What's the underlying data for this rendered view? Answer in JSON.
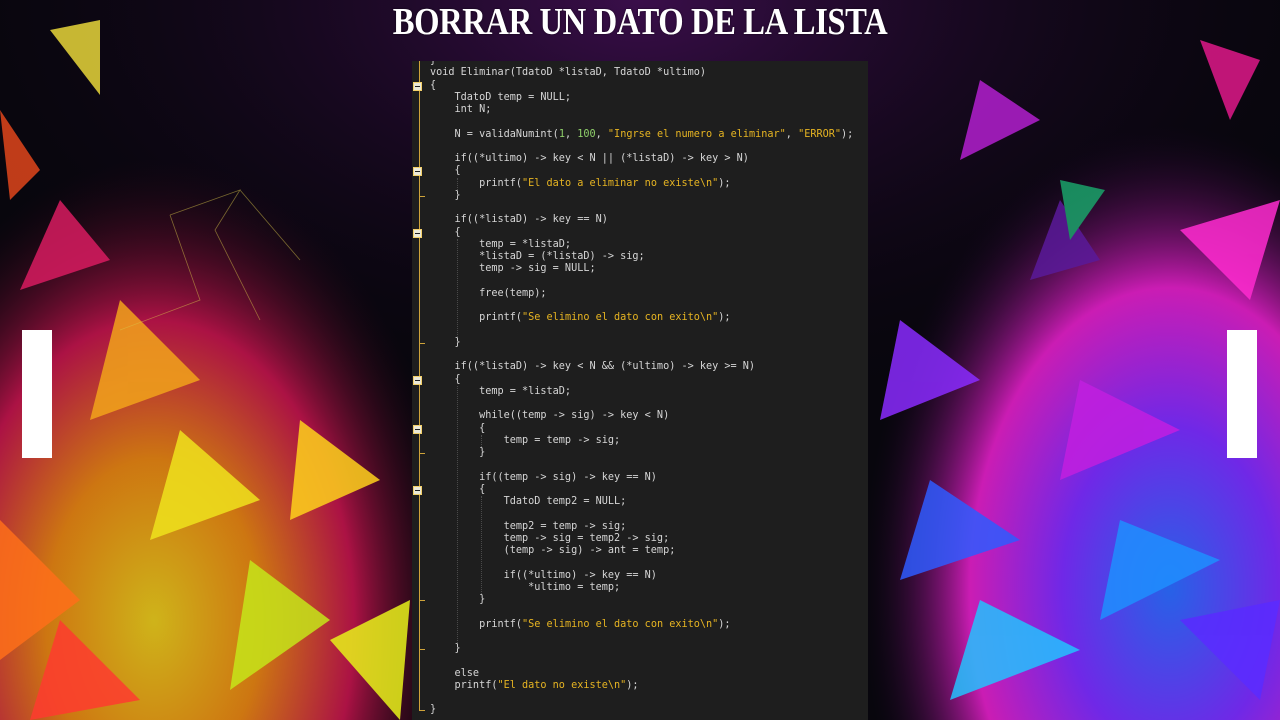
{
  "slide": {
    "title": "BORRAR UN DATO DE LA LISTA",
    "nav": {
      "prev_label": "",
      "next_label": ""
    }
  },
  "colors": {
    "editor_bg": "#1e1e1e",
    "code_text": "#d6d6d6",
    "string": "#e6b422",
    "number": "#8fcf6a",
    "fold_marker": "#cfa33a"
  },
  "editor": {
    "lines": [
      "}",
      "void Eliminar(TdatoD *listaD, TdatoD *ultimo)",
      "{",
      "    TdatoD temp = NULL;",
      "    int N;",
      "",
      "    N = validaNumint(1, 100, \"Ingrse el numero a eliminar\", \"ERROR\");",
      "",
      "    if((*ultimo) -> key < N || (*listaD) -> key > N)",
      "    {",
      "        printf(\"El dato a eliminar no existe\\n\");",
      "    }",
      "",
      "    if((*listaD) -> key == N)",
      "    {",
      "        temp = *listaD;",
      "        *listaD = (*listaD) -> sig;",
      "        temp -> sig = NULL;",
      "",
      "        free(temp);",
      "",
      "        printf(\"Se elimino el dato con exito\\n\");",
      "",
      "    }",
      "",
      "    if((*listaD) -> key < N && (*ultimo) -> key >= N)",
      "    {",
      "        temp = *listaD;",
      "",
      "        while((temp -> sig) -> key < N)",
      "        {",
      "            temp = temp -> sig;",
      "        }",
      "",
      "        if((temp -> sig) -> key == N)",
      "        {",
      "            TdatoD temp2 = NULL;",
      "",
      "            temp2 = temp -> sig;",
      "            temp -> sig = temp2 -> sig;",
      "            (temp -> sig) -> ant = temp;",
      "",
      "            if((*ultimo) -> key == N)",
      "                *ultimo = temp;",
      "        }",
      "",
      "        printf(\"Se elimino el dato con exito\\n\");",
      "",
      "    }",
      "",
      "    else",
      "    printf(\"El dato no existe\\n\");",
      "",
      "}"
    ],
    "fold_marker_lines": [
      2,
      9,
      14,
      26,
      30,
      35
    ],
    "fold_end_lines": [
      11,
      23,
      32,
      44,
      48,
      53
    ]
  }
}
